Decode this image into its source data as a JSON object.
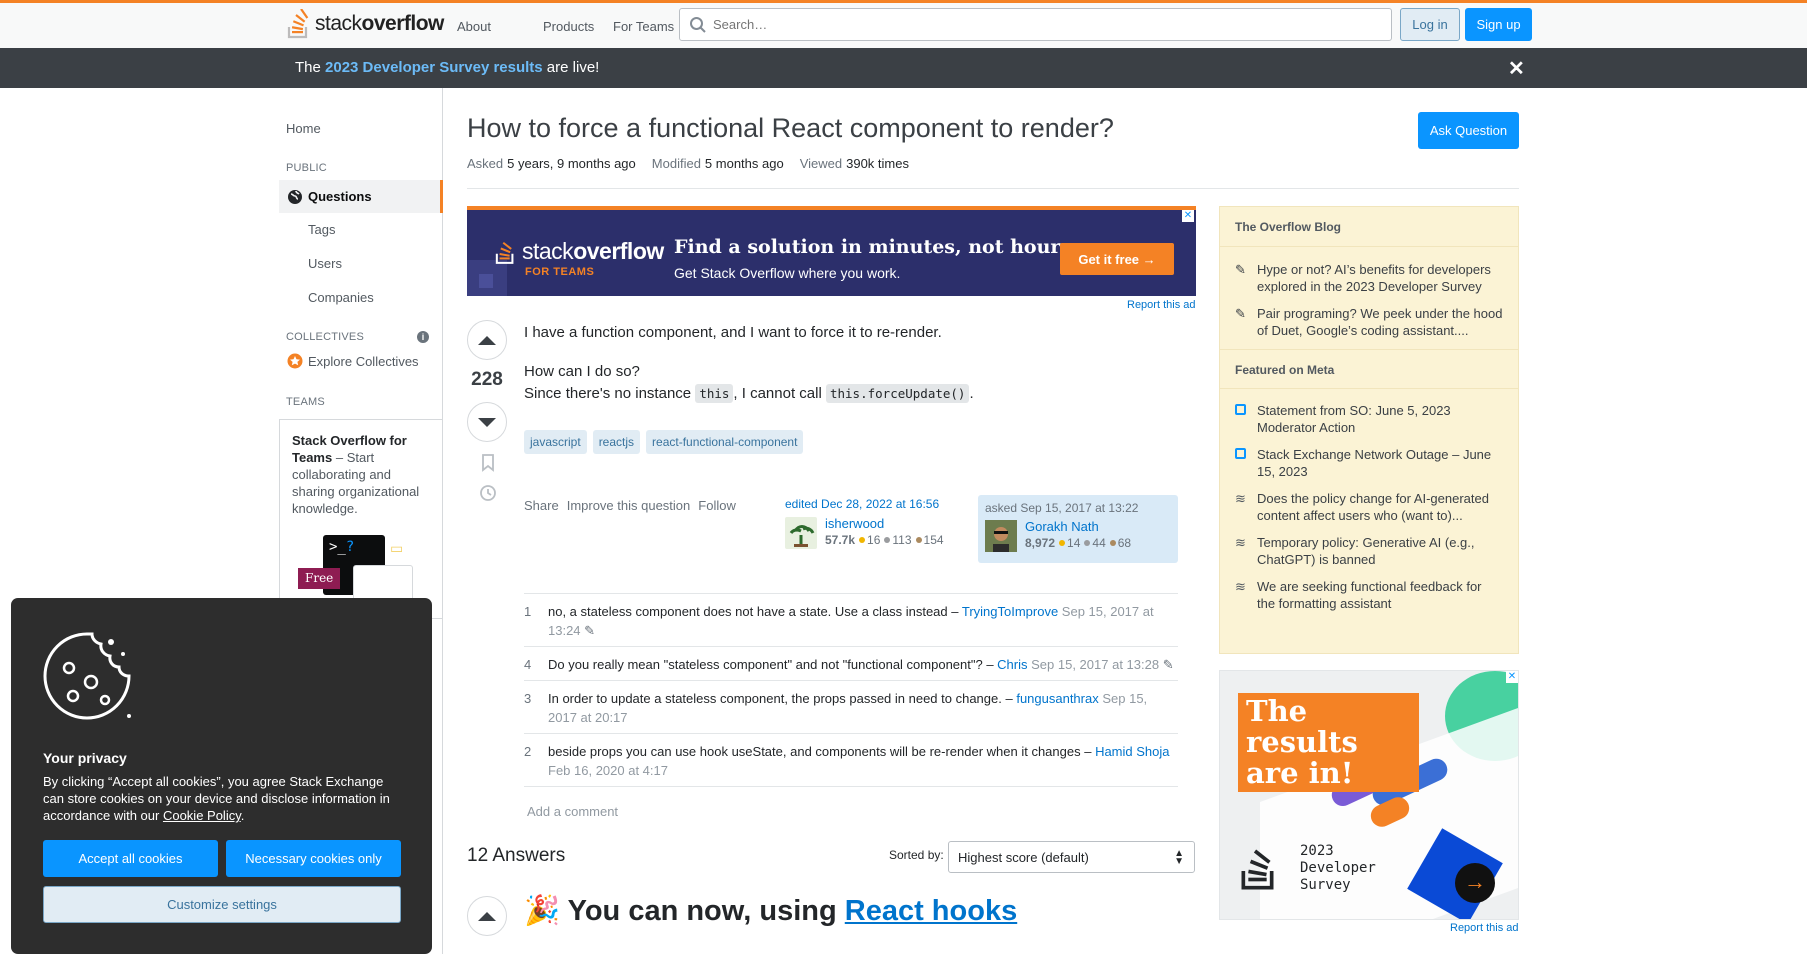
{
  "header": {
    "logo_text_a": "stack",
    "logo_text_b": "overflow",
    "nav": [
      "About",
      "Products",
      "For Teams"
    ],
    "search_placeholder": "Search…",
    "login": "Log in",
    "signup": "Sign up"
  },
  "banner": {
    "prefix": "The ",
    "link": "2023 Developer Survey results",
    "suffix": " are live!"
  },
  "sidebar": {
    "home": "Home",
    "public_head": "PUBLIC",
    "questions": "Questions",
    "tags": "Tags",
    "users": "Users",
    "companies": "Companies",
    "collectives_head": "COLLECTIVES",
    "explore": "Explore Collectives",
    "teams_head": "TEAMS",
    "teams_title": "Stack Overflow for Teams",
    "teams_desc": " – Start collaborating and sharing organizational knowledge.",
    "free_badge": "Free"
  },
  "question": {
    "title": "How to force a functional React component to render?",
    "ask_button": "Ask Question",
    "asked_label": "Asked",
    "asked_value": "5 years, 9 months ago",
    "modified_label": "Modified",
    "modified_value": "5 months ago",
    "viewed_label": "Viewed",
    "viewed_value": "390k times",
    "votes": "228",
    "body_1": "I have a function component, and I want to force it to re-render.",
    "body_2": "How can I do so?",
    "body_3a": "Since there's no instance ",
    "body_3_code1": "this",
    "body_3b": ", I cannot call ",
    "body_3_code2": "this.forceUpdate()",
    "body_3c": ".",
    "tags": [
      "javascript",
      "reactjs",
      "react-functional-component"
    ],
    "actions": [
      "Share",
      "Improve this question",
      "Follow"
    ],
    "edited": "edited Dec 28, 2022 at 16:56",
    "editor_name": "isherwood",
    "editor_rep": "57.7k",
    "editor_gold": "16",
    "editor_silver": "113",
    "editor_bronze": "154",
    "asked_card": "asked Sep 15, 2017 at 13:22",
    "asker_name": "Gorakh Nath",
    "asker_rep": "8,972",
    "asker_gold": "14",
    "asker_silver": "44",
    "asker_bronze": "68"
  },
  "ad": {
    "brand_a": "stack",
    "brand_b": "overflow",
    "brand_sub": "FOR TEAMS",
    "headline": "Find a solution in minutes, not hours.",
    "sub": "Get Stack Overflow where you work.",
    "cta": "Get it free →",
    "report": "Report this ad"
  },
  "comments": [
    {
      "score": "1",
      "text": "no, a stateless component does not have a state. Use a class instead – ",
      "user": "TryingToImprove",
      "date": " Sep 15, 2017 at 13:24"
    },
    {
      "score": "4",
      "text": "Do you really mean \"stateless component\" and not \"functional component\"? – ",
      "user": "Chris",
      "date": " Sep 15, 2017 at 13:28"
    },
    {
      "score": "3",
      "text": "In order to update a stateless component, the props passed in need to change. – ",
      "user": "fungusanthrax",
      "date": " Sep 15, 2017 at 20:17"
    },
    {
      "score": "2",
      "text": "beside props you can use hook useState, and components will be re-render when it changes – ",
      "user": "Hamid Shoja",
      "date": " Feb 16, 2020 at 4:17"
    }
  ],
  "add_comment": "Add a comment",
  "answers": {
    "count_label": "12 Answers",
    "sorted_by": "Sorted by:",
    "sort_value": "Highest score (default)",
    "first_heading_prefix": "🎉 You can now, using ",
    "first_heading_link": "React hooks"
  },
  "blog": {
    "head": "The Overflow Blog",
    "items": [
      "Hype or not? AI’s benefits for developers explored in the 2023 Developer Survey",
      "Pair programing? We peek under the hood of Duet, Google’s coding assistant...."
    ],
    "meta_head": "Featured on Meta",
    "meta_items": [
      "Statement from SO: June 5, 2023 Moderator Action",
      "Stack Exchange Network Outage – June 15, 2023",
      "Does the policy change for AI-generated content affect users who (want to)...",
      "Temporary policy: Generative AI (e.g., ChatGPT) is banned",
      "We are seeking functional feedback for the formatting assistant"
    ]
  },
  "ad2": {
    "title": "The results are in!",
    "survey": "2023 Developer Survey",
    "report": "Report this ad"
  },
  "cookie": {
    "title": "Your privacy",
    "body": "By clicking “Accept all cookies”, you agree Stack Exchange can store cookies on your device and disclose information in accordance with our ",
    "policy_link": "Cookie Policy",
    "body_end": ".",
    "accept": "Accept all cookies",
    "necessary": "Necessary cookies only",
    "customize": "Customize settings"
  },
  "colors": {
    "accent": "#f48225",
    "primary": "#0a95ff",
    "banner": "#3b4045"
  }
}
